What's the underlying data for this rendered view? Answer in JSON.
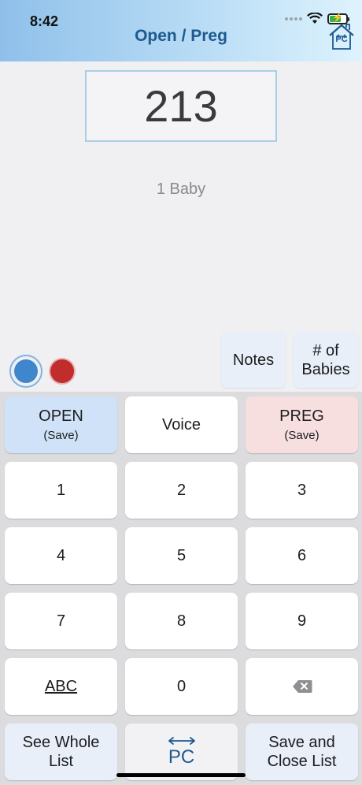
{
  "status_bar": {
    "time": "8:42"
  },
  "header": {
    "title": "Open / Preg",
    "logo_text": "PC"
  },
  "display": {
    "value": "213"
  },
  "baby_count_label": "1 Baby",
  "buttons": {
    "notes": "Notes",
    "babies_line1": "# of",
    "babies_line2": "Babies"
  },
  "keypad": {
    "open_label": "OPEN",
    "open_sub": "(Save)",
    "voice": "Voice",
    "preg_label": "PREG",
    "preg_sub": "(Save)",
    "k1": "1",
    "k2": "2",
    "k3": "3",
    "k4": "4",
    "k5": "5",
    "k6": "6",
    "k7": "7",
    "k8": "8",
    "k9": "9",
    "abc": "ABC",
    "k0": "0",
    "see_whole_line1": "See Whole",
    "see_whole_line2": "List",
    "pc_label": "PC",
    "save_close_line1": "Save and",
    "save_close_line2": "Close List"
  },
  "colors": {
    "header_start": "#8fc0ea",
    "header_end": "#def3fd",
    "title": "#1e5a8e",
    "open_key": "#cfe2f8",
    "preg_key": "#f7dfe0",
    "blue_dot": "#3f87cc",
    "red_dot": "#c12c2c"
  },
  "icons": [
    "wifi-icon",
    "battery-charging-icon",
    "home-logo-icon",
    "backspace-icon",
    "swap-arrow-icon"
  ]
}
